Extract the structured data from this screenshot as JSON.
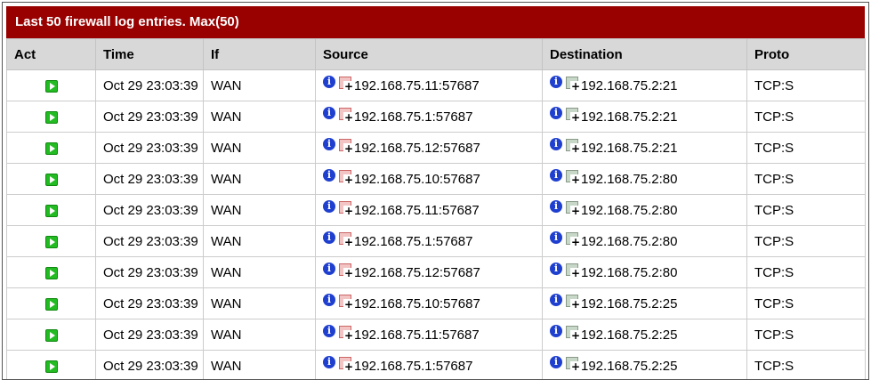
{
  "panel": {
    "title": "Last 50 firewall log entries. Max(50)"
  },
  "columns": [
    "Act",
    "Time",
    "If",
    "Source",
    "Destination",
    "Proto"
  ],
  "icons": {
    "action": "pass-icon",
    "info": "info-icon",
    "source_rule": "easy-rule-block-icon",
    "destination_rule": "easy-rule-pass-icon"
  },
  "colors": {
    "title_bar": "#990000",
    "header_bg": "#d8d8d8",
    "pass_green": "#22bb22",
    "info_blue": "#1f3fcf"
  },
  "rows": [
    {
      "time": "Oct 29 23:03:39",
      "interface": "WAN",
      "source": "192.168.75.11:57687",
      "destination": "192.168.75.2:21",
      "proto": "TCP:S"
    },
    {
      "time": "Oct 29 23:03:39",
      "interface": "WAN",
      "source": "192.168.75.1:57687",
      "destination": "192.168.75.2:21",
      "proto": "TCP:S"
    },
    {
      "time": "Oct 29 23:03:39",
      "interface": "WAN",
      "source": "192.168.75.12:57687",
      "destination": "192.168.75.2:21",
      "proto": "TCP:S"
    },
    {
      "time": "Oct 29 23:03:39",
      "interface": "WAN",
      "source": "192.168.75.10:57687",
      "destination": "192.168.75.2:80",
      "proto": "TCP:S"
    },
    {
      "time": "Oct 29 23:03:39",
      "interface": "WAN",
      "source": "192.168.75.11:57687",
      "destination": "192.168.75.2:80",
      "proto": "TCP:S"
    },
    {
      "time": "Oct 29 23:03:39",
      "interface": "WAN",
      "source": "192.168.75.1:57687",
      "destination": "192.168.75.2:80",
      "proto": "TCP:S"
    },
    {
      "time": "Oct 29 23:03:39",
      "interface": "WAN",
      "source": "192.168.75.12:57687",
      "destination": "192.168.75.2:80",
      "proto": "TCP:S"
    },
    {
      "time": "Oct 29 23:03:39",
      "interface": "WAN",
      "source": "192.168.75.10:57687",
      "destination": "192.168.75.2:25",
      "proto": "TCP:S"
    },
    {
      "time": "Oct 29 23:03:39",
      "interface": "WAN",
      "source": "192.168.75.11:57687",
      "destination": "192.168.75.2:25",
      "proto": "TCP:S"
    },
    {
      "time": "Oct 29 23:03:39",
      "interface": "WAN",
      "source": "192.168.75.1:57687",
      "destination": "192.168.75.2:25",
      "proto": "TCP:S"
    }
  ]
}
